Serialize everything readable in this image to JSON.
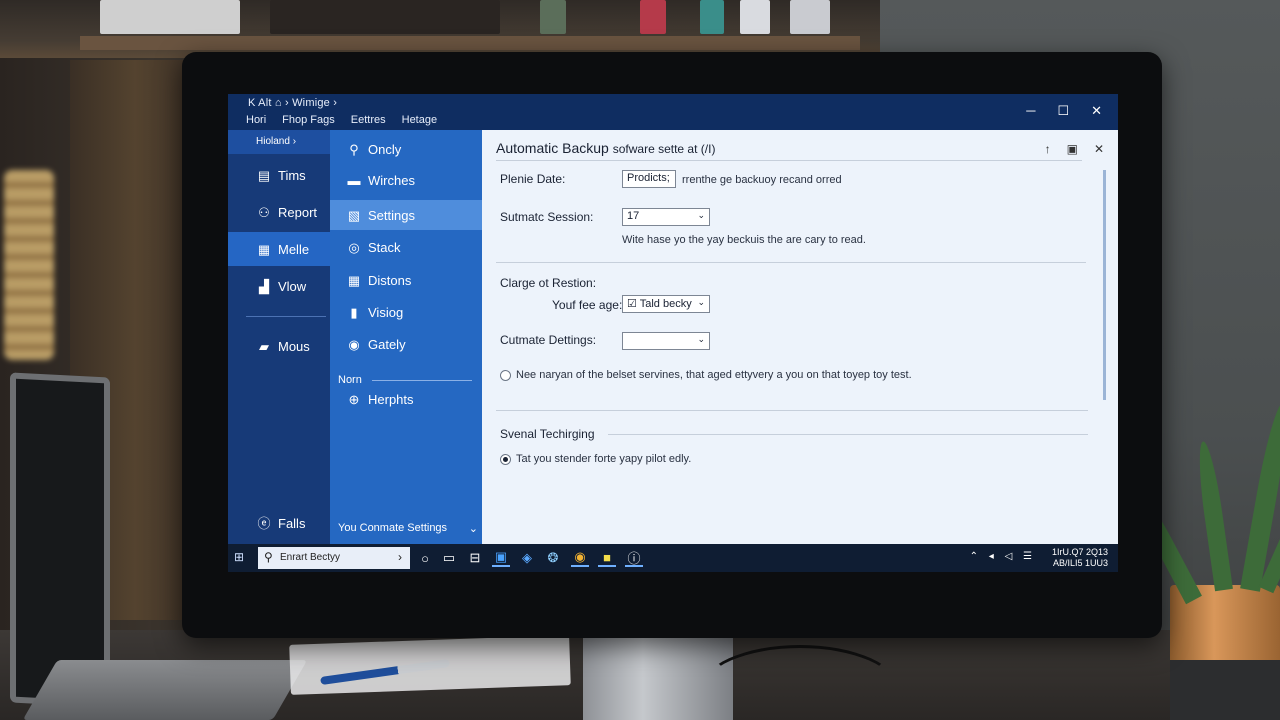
{
  "window": {
    "title_path": "K  Alt ⌂ ›  Wimige ›",
    "menu": [
      "Hori",
      "Fhop Fags",
      "Eettres",
      "Hetage"
    ]
  },
  "nav": {
    "header": "Hioland ›",
    "items": [
      {
        "label": "Tims",
        "icon": "document-icon"
      },
      {
        "label": "Report",
        "icon": "report-icon"
      },
      {
        "label": "Melle",
        "icon": "grid-icon"
      },
      {
        "label": "Vlow",
        "icon": "chart-icon"
      },
      {
        "label": "Mous",
        "icon": "folder-icon"
      }
    ],
    "footer": "Falls"
  },
  "mid": {
    "items": [
      {
        "label": "Oncly",
        "icon": "person-icon"
      },
      {
        "label": "Wirches",
        "icon": "car-icon"
      },
      {
        "label": "Settings",
        "icon": "settings-icon"
      },
      {
        "label": "Stack",
        "icon": "pin-icon"
      },
      {
        "label": "Distons",
        "icon": "grid-icon"
      },
      {
        "label": "Visiog",
        "icon": "page-icon"
      },
      {
        "label": "Gately",
        "icon": "gallery-icon"
      }
    ],
    "section_label": "Norn",
    "section_item": {
      "label": "Herphts",
      "icon": "globe-icon"
    },
    "footer": "You Conmate Settings"
  },
  "content": {
    "title": "Automatic Backup",
    "title_small": "sofware sette at (/I)",
    "plenie_date_label": "Plenie Date:",
    "plenie_date_value": "Prodicts;",
    "plenie_date_note": "rrenthe ge backuoy recand orred",
    "session_label": "Sutmatc Session:",
    "session_value": "17",
    "session_note": "Wite hase yo the yay beckuis the are cary to read.",
    "clarge_label": "Clarge ot Restion:",
    "fee_label": "Youf fee age:",
    "fee_value": "Tald becky",
    "cutmate_label": "Cutmate Dettings:",
    "cutmate_value": "",
    "radio1_text": "Nee naryan of the belset servines, that aged ettyvery a you on that toyep toy test.",
    "section2_title": "Svenal Techirging",
    "radio2_text": "Tat you stender forte yapy pilot edly."
  },
  "taskbar": {
    "search_text": "Enrart Bectyy",
    "tray": "⌃ ◂ ◁ ☰",
    "clock_line1": "1IrU.Q7  2Q13",
    "clock_line2": "AB/ILI5  1UU3"
  },
  "colors": {
    "title_blue": "#0f2d61",
    "nav_blue": "#173a78",
    "active_blue": "#2566c4",
    "mid_blue": "#2568c2",
    "content_bg": "#edf3fb"
  }
}
